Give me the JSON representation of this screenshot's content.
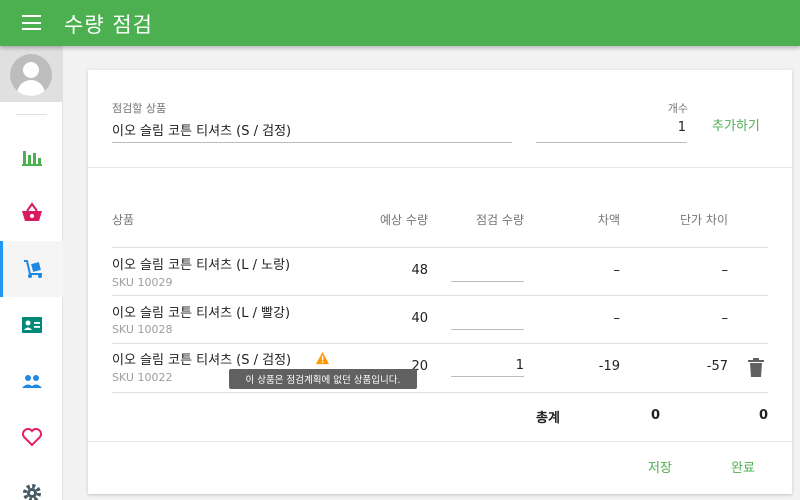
{
  "app_title": "수량 점검",
  "form": {
    "product_label": "점검할 상품",
    "product_value": "이오 슬림 코튼 티셔츠 (S / 검정)",
    "count_label": "개수",
    "count_value": "1",
    "add_button": "추가하기"
  },
  "table": {
    "headers": {
      "product": "상품",
      "expected": "예상 수량",
      "checked": "점검 수량",
      "diff": "차액",
      "price_diff": "단가 차이"
    },
    "rows": [
      {
        "name": "이오 슬림 코튼 티셔츠 (L / 노랑)",
        "sku": "SKU 10029",
        "expected": "48",
        "checked": "",
        "diff": "–",
        "price_diff": "–"
      },
      {
        "name": "이오 슬림 코튼 티셔츠 (L / 빨강)",
        "sku": "SKU 10028",
        "expected": "40",
        "checked": "",
        "diff": "–",
        "price_diff": "–"
      },
      {
        "name": "이오 슬림 코튼 티셔츠 (S / 검정)",
        "sku": "SKU 10022",
        "expected": "20",
        "checked": "1",
        "diff": "-19",
        "price_diff": "-57"
      }
    ],
    "tooltip": "이 상품은 점검계획에 없던 상품입니다.",
    "total_label": "총계",
    "total_diff": "0",
    "total_price_diff": "0"
  },
  "footer": {
    "save_button": "저장",
    "complete_button": "완료"
  },
  "colors": {
    "primary": "#4caf50",
    "active_indicator": "#2196f3",
    "warning": "#ff9800"
  },
  "icons": {
    "nav": [
      "bar-chart-icon",
      "basket-icon",
      "dolly-icon",
      "contact-card-icon",
      "people-icon",
      "heart-icon",
      "gear-icon"
    ]
  }
}
